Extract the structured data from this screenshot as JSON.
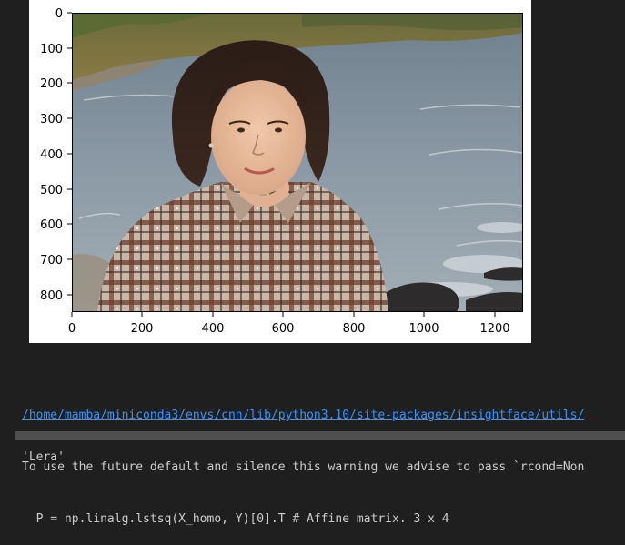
{
  "plot": {
    "image_description": "Portrait photograph of a young woman with dark shoulder-length hair wearing a plaid shirt, standing by the sea shore with waves and rocks in the background",
    "y_ticks": [
      "0",
      "100",
      "200",
      "300",
      "400",
      "500",
      "600",
      "700",
      "800"
    ],
    "x_ticks": [
      "0",
      "200",
      "400",
      "600",
      "800",
      "1000",
      "1200"
    ]
  },
  "stderr": {
    "warning_path": "/home/mamba/miniconda3/envs/cnn/lib/python3.10/site-packages/insightface/utils/",
    "warning_message": "To use the future default and silence this warning we advise to pass `rcond=Non",
    "code_line": "  P = np.linalg.lstsq(X_homo, Y)[0].T # Affine matrix. 3 x 4"
  },
  "result": {
    "value": "'Lera'"
  },
  "colors": {
    "background": "#1f1f1f",
    "text": "#cccccc",
    "link": "#3794ff",
    "plot_background": "#ffffff"
  }
}
